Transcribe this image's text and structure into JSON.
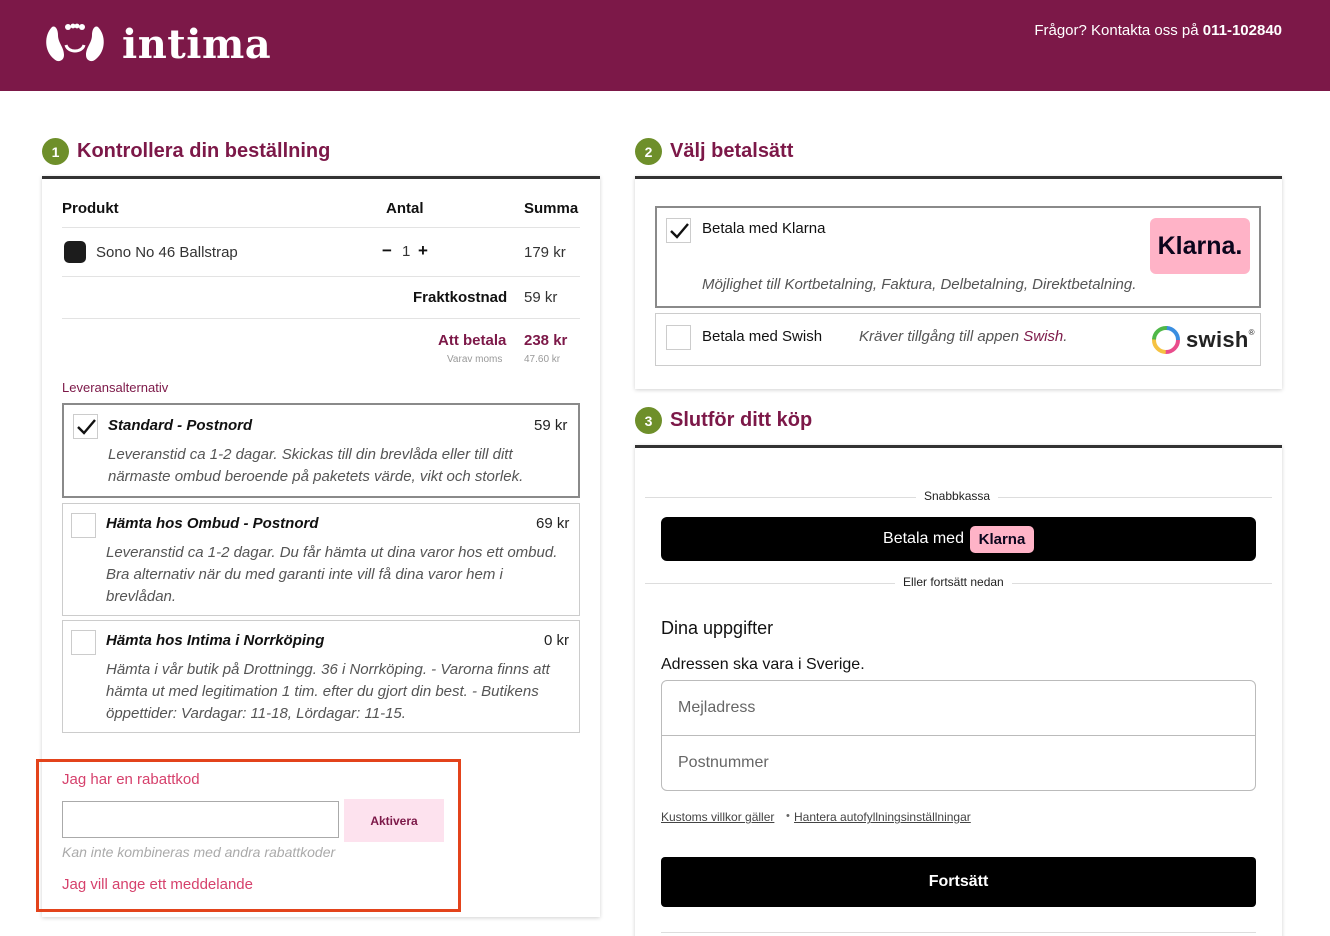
{
  "header": {
    "brand": "intima",
    "contact_text": "Frågor? Kontakta oss på",
    "contact_phone": "011-102840"
  },
  "order": {
    "step": "1",
    "title": "Kontrollera din beställning",
    "col_product": "Produkt",
    "col_qty": "Antal",
    "col_sum": "Summa",
    "item_name": "Sono No 46 Ballstrap",
    "item_qty": "1",
    "qty_minus": "−",
    "qty_plus": "+",
    "item_sum": "179 kr",
    "shipping_label": "Fraktkostnad",
    "shipping_value": "59 kr",
    "total_label": "Att betala",
    "total_value": "238 kr",
    "vat_label": "Varav moms",
    "vat_value": "47.60 kr",
    "delivery_heading": "Leveransalternativ",
    "delivery_options": [
      {
        "title": "Standard - Postnord",
        "price": "59 kr",
        "desc": "Leveranstid ca 1-2 dagar. Skickas till din brevlåda eller till ditt närmaste ombud beroende på paketets värde, vikt och storlek.",
        "checked": true
      },
      {
        "title": "Hämta hos Ombud - Postnord",
        "price": "69 kr",
        "desc": "Leveranstid ca 1-2 dagar. Du får hämta ut dina varor hos ett ombud. Bra alternativ när du med garanti inte vill få dina varor hem i brevlådan.",
        "checked": false
      },
      {
        "title": "Hämta hos Intima i Norrköping",
        "price": "0 kr",
        "desc": "Hämta i vår butik på Drottningg. 36 i Norrköping. - Varorna finns att hämta ut med legitimation 1 tim. efter du gjort din best. - Butikens öppettider: Vardagar: 11-18, Lördagar: 11-15.",
        "checked": false
      }
    ],
    "discount_link": "Jag har en rabattkod",
    "discount_value": "",
    "discount_button": "Aktivera",
    "discount_note": "Kan inte kombineras med andra rabattkoder",
    "message_link": "Jag vill ange ett meddelande"
  },
  "payment": {
    "step": "2",
    "title": "Välj betalsätt",
    "klarna_label": "Betala med Klarna",
    "klarna_badge": "Klarna.",
    "klarna_desc": "Möjlighet till Kortbetalning, Faktura, Delbetalning, Direktbetalning.",
    "swish_label": "Betala med Swish",
    "swish_desc_prefix": "Kräver tillgång till appen",
    "swish_desc_link": "Swish",
    "swish_desc_suffix": ".",
    "swish_logo": "swish",
    "swish_reg": "®"
  },
  "checkout": {
    "step": "3",
    "title": "Slutför ditt köp",
    "express_label": "Snabbkassa",
    "klarna_btn_prefix": "Betala med",
    "klarna_btn_badge": "Klarna",
    "or_label": "Eller fortsätt nedan",
    "details_heading": "Dina uppgifter",
    "address_note": "Adressen ska vara i Sverige.",
    "email_placeholder": "Mejladress",
    "postcode_placeholder": "Postnummer",
    "terms_link": "Kustoms villkor gäller",
    "bullet": "•",
    "autofill_link": "Hantera autofyllningsinställningar",
    "continue_button": "Fortsätt"
  },
  "colors": {
    "brand": "#7c1848",
    "step_badge": "#6e8f2a",
    "klarna_pink": "#ffb3c7",
    "highlight": "#e3431b",
    "link_pink": "#d6416c"
  }
}
